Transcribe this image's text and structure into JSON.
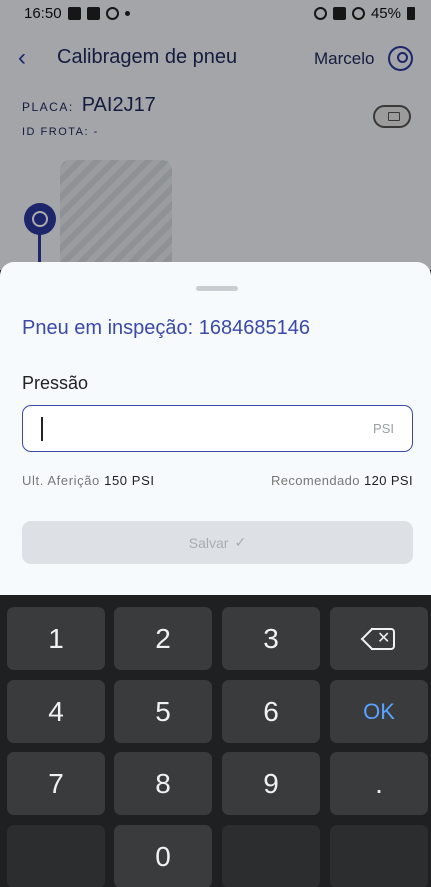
{
  "statusbar": {
    "time": "16:50",
    "battery": "45%"
  },
  "header": {
    "title": "Calibragem de pneu",
    "user_name": "Marcelo"
  },
  "vehicle": {
    "placa_label": "PLACA:",
    "placa_value": "PAI2J17",
    "frota_label": "ID FROTA: -"
  },
  "sheet": {
    "title": "Pneu em inspeção: 1684685146",
    "pressure_label": "Pressão",
    "pressure_value": "",
    "unit": "PSI",
    "last_label": "Ult. Aferição",
    "last_value": "150 PSI",
    "recommended_label": "Recomendado",
    "recommended_value": "120 PSI",
    "save_label": "Salvar",
    "save_check": "✓"
  },
  "keyboard": {
    "k1": "1",
    "k2": "2",
    "k3": "3",
    "k4": "4",
    "k5": "5",
    "k6": "6",
    "k7": "7",
    "k8": "8",
    "k9": "9",
    "k0": "0",
    "dot": ".",
    "ok": "OK"
  },
  "colors": {
    "accent": "#3b49a8",
    "ok": "#5aa2ff"
  }
}
